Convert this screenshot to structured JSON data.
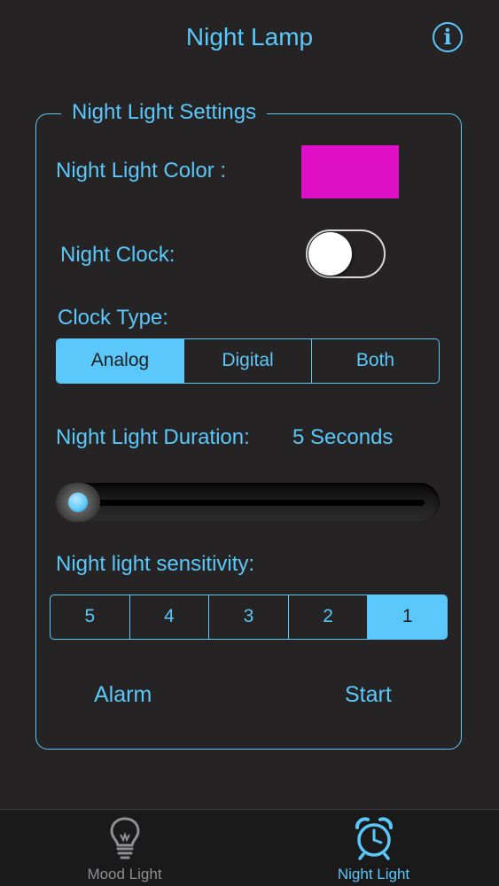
{
  "header": {
    "title": "Night Lamp",
    "info_label": "i"
  },
  "settings": {
    "legend": "Night Light Settings",
    "color_label": "Night Light Color :",
    "color_value": "#e010c8",
    "night_clock_label": "Night Clock:",
    "night_clock_on": false,
    "clock_type_label": "Clock Type:",
    "clock_types": [
      "Analog",
      "Digital",
      "Both"
    ],
    "clock_type_selected": "Analog",
    "duration_label": "Night Light Duration:",
    "duration_value": "5 Seconds",
    "duration_slider_fraction": 0.0,
    "sensitivity_label": "Night light sensitivity:",
    "sensitivity_options": [
      "5",
      "4",
      "3",
      "2",
      "1"
    ],
    "sensitivity_selected": "1",
    "alarm_label": "Alarm",
    "start_label": "Start"
  },
  "tabs": [
    {
      "label": "Mood Light",
      "icon": "lightbulb-icon",
      "active": false
    },
    {
      "label": "Night Light",
      "icon": "alarm-clock-icon",
      "active": true
    }
  ],
  "colors": {
    "accent": "#5ac8fa",
    "background": "#252323",
    "inactive": "#8e8e93"
  }
}
